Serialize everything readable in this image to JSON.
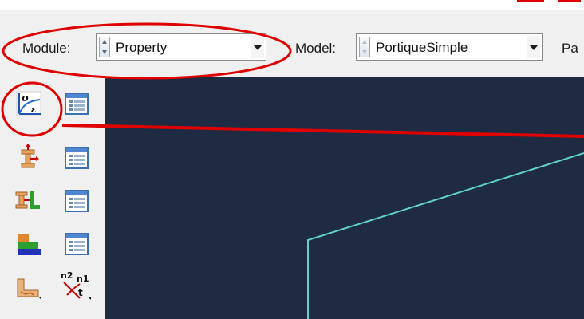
{
  "context_bar": {
    "module": {
      "label": "Module:",
      "value": "Property"
    },
    "model": {
      "label": "Model:",
      "value": "PortiqueSimple"
    },
    "part": {
      "label": "Pa"
    }
  },
  "toolbox": {
    "items": [
      {
        "icon": "material-stress-strain-icon",
        "symbol_sigma": "σ",
        "symbol_epsilon": "ε"
      },
      {
        "icon": "material-manager-icon"
      },
      {
        "icon": "section-create-icon"
      },
      {
        "icon": "section-manager-icon"
      },
      {
        "icon": "profile-create-icon"
      },
      {
        "icon": "profile-manager-icon"
      },
      {
        "icon": "assign-section-icon"
      },
      {
        "icon": "section-assignment-manager-icon"
      },
      {
        "icon": "assign-orientation-icon"
      },
      {
        "icon": "beam-orientation-icon",
        "symbol_n2": "n2",
        "symbol_n1": "n1",
        "symbol_t": "t"
      }
    ]
  },
  "colors": {
    "viewport_bg": "#1f2b43",
    "frame_line": "#5fd3c6",
    "annotation_red": "#e00000"
  }
}
